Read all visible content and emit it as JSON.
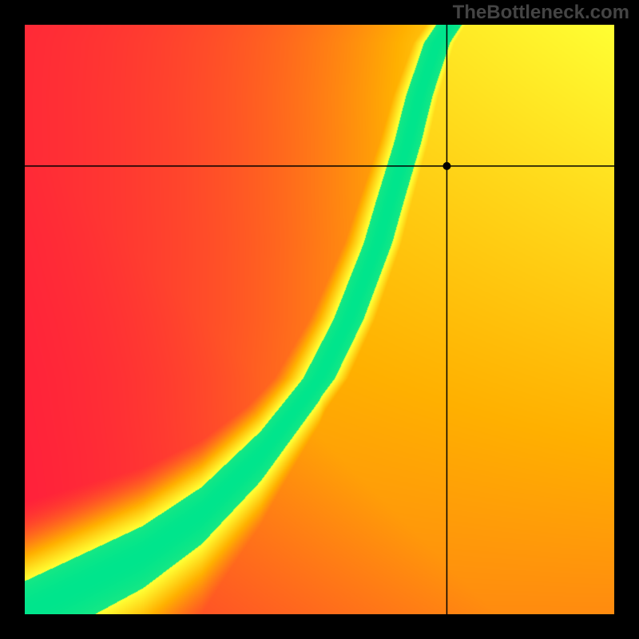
{
  "watermark": "TheBottleneck.com",
  "chart_data": {
    "type": "heatmap",
    "title": "",
    "xlabel": "",
    "ylabel": "",
    "xlim": [
      0,
      1
    ],
    "ylim": [
      0,
      1
    ],
    "crosshair": {
      "x": 0.717,
      "y": 0.76
    },
    "optimal_curve": {
      "description": "Green ridge of optimal pairings (x is normalized horizontal position, y is normalized vertical position from bottom).",
      "x": [
        0.0,
        0.1,
        0.2,
        0.3,
        0.4,
        0.5,
        0.55,
        0.6,
        0.62,
        0.65,
        0.67,
        0.7,
        0.72
      ],
      "y": [
        0.0,
        0.05,
        0.1,
        0.17,
        0.27,
        0.4,
        0.5,
        0.63,
        0.7,
        0.8,
        0.88,
        0.97,
        1.0
      ]
    },
    "colorscale": [
      {
        "stop": 0.0,
        "color": "#ff163f"
      },
      {
        "stop": 0.5,
        "color": "#ffb000"
      },
      {
        "stop": 0.8,
        "color": "#ffff33"
      },
      {
        "stop": 1.0,
        "color": "#00e58c"
      }
    ],
    "field_description": "Scalar field peaking (green) along the optimal_curve and falling off to red with distance; upper-right quadrant plateaus to orange/yellow."
  }
}
